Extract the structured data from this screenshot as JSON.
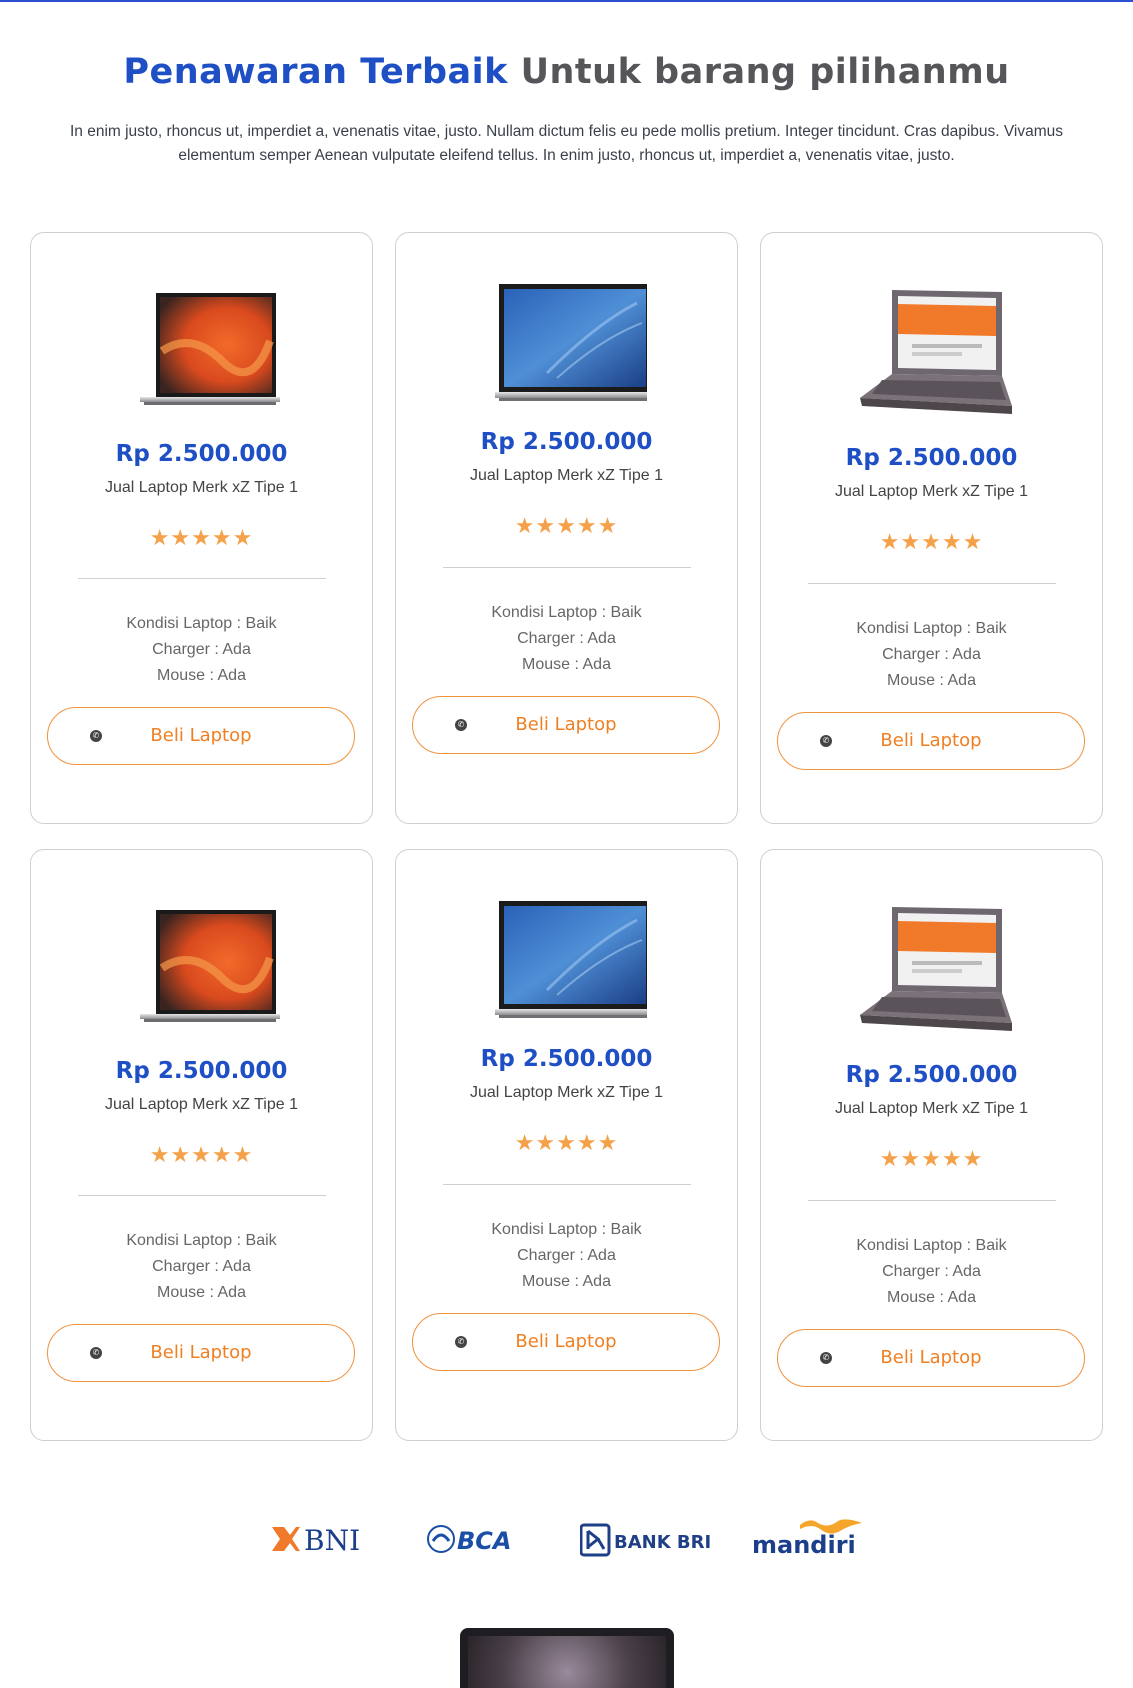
{
  "header": {
    "title_accent": "Penawaran Terbaik",
    "title_rest": "Untuk barang pilihanmu",
    "description": "In enim justo, rhoncus ut, imperdiet a, venenatis vitae, justo. Nullam dictum felis eu pede mollis pretium. Integer tincidunt. Cras dapibus. Vivamus elementum semper Aenean vulputate eleifend tellus. In enim justo, rhoncus ut, imperdiet a, venenatis vitae, justo."
  },
  "colors": {
    "accent": "#1f4fc4",
    "orange": "#f07f22",
    "stars": "#f5a14a"
  },
  "products": [
    {
      "image": "laptop-orange-screen",
      "price": "Rp 2.500.000",
      "name": "Jual Laptop Merk xZ Tipe 1",
      "rating": 5,
      "stars": "★★★★★",
      "kondisi": "Kondisi Laptop : Baik",
      "charger": "Charger : Ada",
      "mouse": "Mouse : Ada",
      "button": "Beli Laptop",
      "button_icon": "whatsapp-icon"
    },
    {
      "image": "laptop-blue-screen",
      "price": "Rp 2.500.000",
      "name": "Jual Laptop Merk xZ Tipe 1",
      "rating": 5,
      "stars": "★★★★★",
      "kondisi": "Kondisi Laptop : Baik",
      "charger": "Charger : Ada",
      "mouse": "Mouse : Ada",
      "button": "Beli Laptop",
      "button_icon": "whatsapp-icon"
    },
    {
      "image": "laptop-angled-website",
      "price": "Rp 2.500.000",
      "name": "Jual Laptop Merk xZ Tipe 1",
      "rating": 5,
      "stars": "★★★★★",
      "kondisi": "Kondisi Laptop : Baik",
      "charger": "Charger : Ada",
      "mouse": "Mouse : Ada",
      "button": "Beli Laptop",
      "button_icon": "whatsapp-icon"
    },
    {
      "image": "laptop-orange-screen",
      "price": "Rp 2.500.000",
      "name": "Jual Laptop Merk xZ Tipe 1",
      "rating": 5,
      "stars": "★★★★★",
      "kondisi": "Kondisi Laptop : Baik",
      "charger": "Charger : Ada",
      "mouse": "Mouse : Ada",
      "button": "Beli Laptop",
      "button_icon": "whatsapp-icon"
    },
    {
      "image": "laptop-blue-screen",
      "price": "Rp 2.500.000",
      "name": "Jual Laptop Merk xZ Tipe 1",
      "rating": 5,
      "stars": "★★★★★",
      "kondisi": "Kondisi Laptop : Baik",
      "charger": "Charger : Ada",
      "mouse": "Mouse : Ada",
      "button": "Beli Laptop",
      "button_icon": "whatsapp-icon"
    },
    {
      "image": "laptop-angled-website",
      "price": "Rp 2.500.000",
      "name": "Jual Laptop Merk xZ Tipe 1",
      "rating": 5,
      "stars": "★★★★★",
      "kondisi": "Kondisi Laptop : Baik",
      "charger": "Charger : Ada",
      "mouse": "Mouse : Ada",
      "button": "Beli Laptop",
      "button_icon": "whatsapp-icon"
    }
  ],
  "banks": [
    "BNI",
    "BCA",
    "BANK BRI",
    "mandiri"
  ]
}
